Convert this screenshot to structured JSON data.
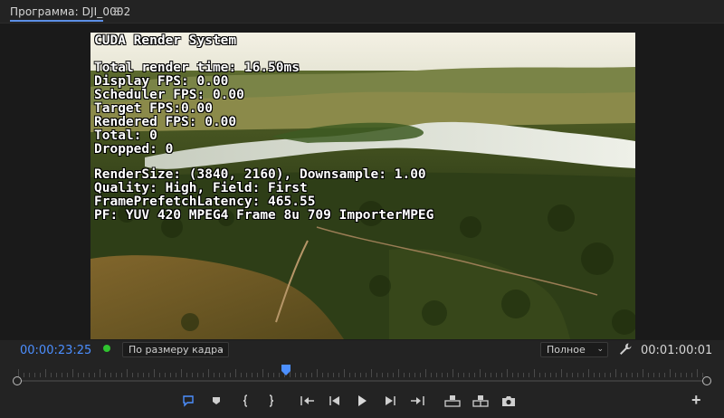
{
  "header": {
    "title": "Программа: DJI_0002",
    "menu_icon": "hamburger-icon"
  },
  "overlay": {
    "lines": [
      "CUDA Render System",
      "Total render time: 16.50ms",
      "Display FPS: 0.00",
      "Scheduler FPS: 0.00",
      "Target FPS:0.00",
      "Rendered FPS: 0.00",
      "Total: 0",
      "Dropped: 0",
      "RenderSize: (3840, 2160), Downsample: 1.00",
      "Quality: High, Field: First",
      "FramePrefetchLatency: 465.55",
      "PF: YUV 420 MPEG4 Frame 8u 709 ImporterMPEG"
    ]
  },
  "controls": {
    "current_timecode": "00:00:23:25",
    "fit": "По размеру кадра",
    "quality": "Полное",
    "duration_timecode": "00:01:00:01"
  },
  "timeline": {
    "playhead_position": 0.39
  },
  "transport": {
    "buttons": [
      "add-marker",
      "mark-in",
      "mark-out",
      "go-to-in",
      "step-back",
      "play",
      "step-forward",
      "go-to-out",
      "lift",
      "extract",
      "export-frame"
    ]
  },
  "colors": {
    "accent": "#4c8fff",
    "status_dot": "#2fc32f",
    "background": "#232323"
  }
}
